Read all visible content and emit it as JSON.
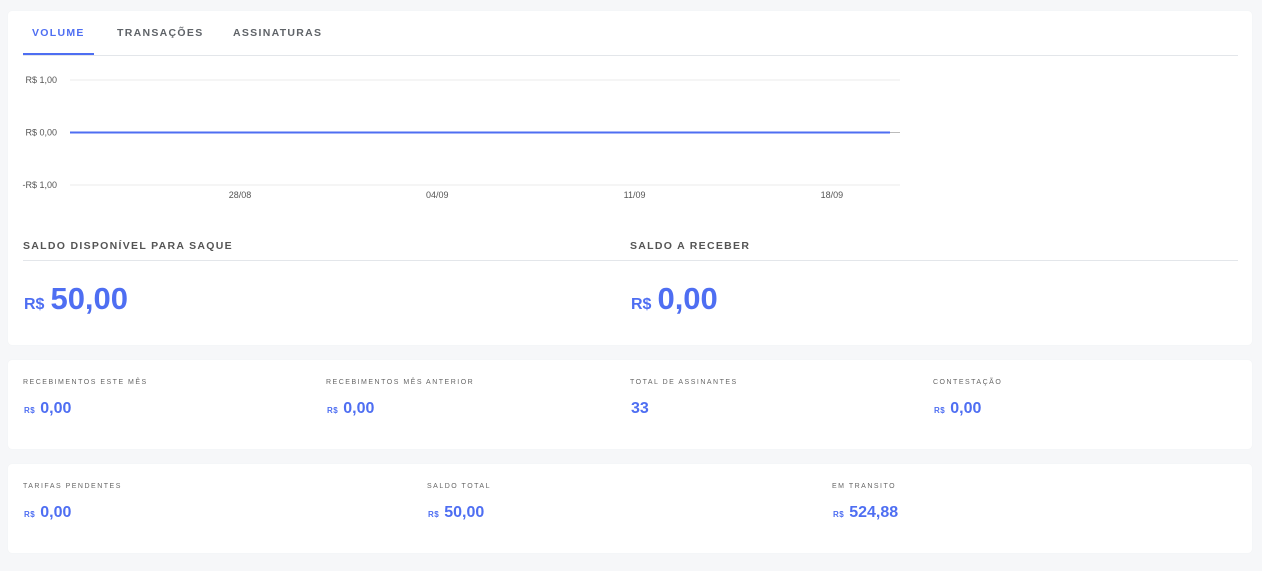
{
  "tabs": [
    "VOLUME",
    "TRANSAÇÕES",
    "ASSINATURAS"
  ],
  "chart_data": {
    "type": "line",
    "x": [
      "28/08",
      "04/09",
      "11/09",
      "18/09"
    ],
    "series": [
      {
        "values": [
          0,
          0,
          0,
          0
        ]
      }
    ],
    "y_ticks": [
      "R$ 1,00",
      "R$ 0,00",
      "-R$ 1,00"
    ],
    "ylim": [
      -1,
      1
    ],
    "line_color": "#4e6ef2"
  },
  "balance": {
    "available_label": "SALDO DISPONÍVEL PARA SAQUE",
    "available_currency": "R$",
    "available_value": "50,00",
    "receivable_label": "SALDO A RECEBER",
    "receivable_currency": "R$",
    "receivable_value": "0,00"
  },
  "stats1": [
    {
      "label": "RECEBIMENTOS ESTE MÊS",
      "currency": "R$",
      "value": "0,00"
    },
    {
      "label": "RECEBIMENTOS MÊS ANTERIOR",
      "currency": "R$",
      "value": "0,00"
    },
    {
      "label": "TOTAL DE ASSINANTES",
      "currency": "",
      "value": "33"
    },
    {
      "label": "CONTESTAÇÃO",
      "currency": "R$",
      "value": "0,00"
    }
  ],
  "stats2": [
    {
      "label": "TARIFAS PENDENTES",
      "currency": "R$",
      "value": "0,00"
    },
    {
      "label": "SALDO TOTAL",
      "currency": "R$",
      "value": "50,00"
    },
    {
      "label": "EM TRANSITO",
      "currency": "R$",
      "value": "524,88"
    }
  ],
  "colors": {
    "accent": "#4e6ef2",
    "background": "#f6f7f9"
  }
}
